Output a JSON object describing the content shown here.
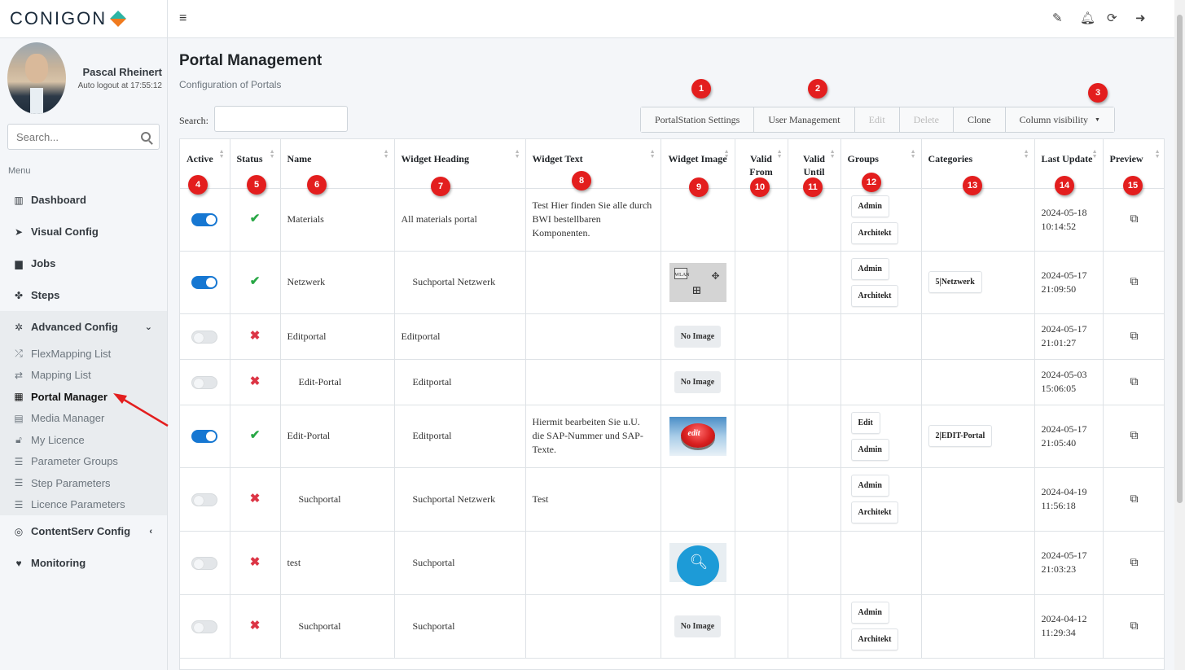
{
  "brand": {
    "name": "CONIGON"
  },
  "user": {
    "name": "Pascal Rheinert",
    "logout_text": "Auto logout at 17:55:12"
  },
  "sidebar": {
    "search_placeholder": "Search...",
    "menu_label": "Menu",
    "items": [
      {
        "label": "Dashboard",
        "icon": "chart-bar-icon",
        "glyph": "▥"
      },
      {
        "label": "Visual Config",
        "icon": "cursor-icon",
        "glyph": "➤"
      },
      {
        "label": "Jobs",
        "icon": "briefcase-icon",
        "glyph": "▆"
      },
      {
        "label": "Steps",
        "icon": "paw-icon",
        "glyph": "✤"
      },
      {
        "label": "Advanced Config",
        "icon": "gear-icon",
        "glyph": "✲",
        "chevron": "⌄"
      }
    ],
    "sub_items": [
      {
        "label": "FlexMapping List",
        "icon": "shuffle-icon",
        "glyph": "⤮"
      },
      {
        "label": "Mapping List",
        "icon": "exchange-icon",
        "glyph": "⇄"
      },
      {
        "label": "Portal Manager",
        "icon": "grid-icon",
        "glyph": "▦",
        "active": true
      },
      {
        "label": "Media Manager",
        "icon": "file-image-icon",
        "glyph": "▤"
      },
      {
        "label": "My Licence",
        "icon": "unlock-icon",
        "glyph": "🔓︎"
      },
      {
        "label": "Parameter Groups",
        "icon": "sliders-icon",
        "glyph": "☰"
      },
      {
        "label": "Step Parameters",
        "icon": "sliders-icon",
        "glyph": "☰"
      },
      {
        "label": "Licence Parameters",
        "icon": "sliders-icon",
        "glyph": "☰"
      }
    ],
    "items_after": [
      {
        "label": "ContentServ Config",
        "icon": "circle-dot-icon",
        "glyph": "◎",
        "chevron": "‹"
      },
      {
        "label": "Monitoring",
        "icon": "heartbeat-icon",
        "glyph": "♥"
      }
    ]
  },
  "page": {
    "title": "Portal Management",
    "subtitle": "Configuration of Portals",
    "search_label": "Search:"
  },
  "toolbar": {
    "buttons": [
      {
        "label": "PortalStation Settings",
        "disabled": false
      },
      {
        "label": "User Management",
        "disabled": false
      },
      {
        "label": "Edit",
        "disabled": true
      },
      {
        "label": "Delete",
        "disabled": true
      },
      {
        "label": "Clone",
        "disabled": false
      },
      {
        "label": "Column visibility",
        "disabled": false,
        "caret": "▼"
      }
    ]
  },
  "table": {
    "headers": [
      "Active",
      "Status",
      "Name",
      "Widget Heading",
      "Widget Text",
      "Widget Image",
      "Valid From",
      "Valid Until",
      "Groups",
      "Categories",
      "Last Update",
      "Preview"
    ],
    "rows": [
      {
        "active": true,
        "status": "ok",
        "name": "Materials",
        "heading": "All materials portal",
        "text": "Test Hier finden Sie alle durch BWI bestellbaren Komponenten.",
        "image": "",
        "groups": [
          "Admin",
          "Architekt"
        ],
        "categories": [],
        "updated": "2024-05-18 10:14:52"
      },
      {
        "active": true,
        "status": "ok",
        "name": "Netzwerk",
        "heading": "Suchportal Netzwerk",
        "text": "",
        "image": "network",
        "image_text": "WLAN",
        "groups": [
          "Admin",
          "Architekt"
        ],
        "categories": [
          "5|Netzwerk"
        ],
        "updated": "2024-05-17 21:09:50"
      },
      {
        "active": false,
        "status": "no",
        "name": "Editportal",
        "heading": "Editportal",
        "text": "",
        "image": "none",
        "groups": [],
        "categories": [],
        "updated": "2024-05-17 21:01:27"
      },
      {
        "active": false,
        "status": "no",
        "name": "Edit-Portal",
        "heading": "Editportal",
        "text": "",
        "image": "none",
        "groups": [],
        "categories": [],
        "updated": "2024-05-03 15:06:05"
      },
      {
        "active": true,
        "status": "ok",
        "name": "Edit-Portal",
        "heading": "Editportal",
        "text": "Hiermit bearbeiten Sie u.U. die SAP-Nummer und SAP-Texte.",
        "image": "edit",
        "image_text": "edit",
        "groups": [
          "Edit",
          "Admin"
        ],
        "categories": [
          "2|EDIT-Portal"
        ],
        "updated": "2024-05-17 21:05:40"
      },
      {
        "active": false,
        "status": "no",
        "name": "Suchportal",
        "heading": "Suchportal Netzwerk",
        "text": "Test",
        "image": "",
        "groups": [
          "Admin",
          "Architekt"
        ],
        "categories": [],
        "updated": "2024-04-19 11:56:18"
      },
      {
        "active": false,
        "status": "no",
        "name": "test",
        "heading": "Suchportal",
        "text": "",
        "image": "search",
        "groups": [],
        "categories": [],
        "updated": "2024-05-17 21:03:23"
      },
      {
        "active": false,
        "status": "no",
        "name": "Suchportal",
        "heading": "Suchportal",
        "text": "",
        "image": "none",
        "groups": [
          "Admin",
          "Architekt"
        ],
        "categories": [],
        "updated": "2024-04-12 11:29:34"
      }
    ],
    "no_image_label": "No Image",
    "status_glyphs": {
      "ok": "✔",
      "no": "✖"
    },
    "preview_glyph": "⧉"
  },
  "annotations": [
    "1",
    "2",
    "3",
    "4",
    "5",
    "6",
    "7",
    "8",
    "9",
    "10",
    "11",
    "12",
    "13",
    "14",
    "15"
  ],
  "colors": {
    "accent": "#1677d2",
    "marker": "#e31e1e",
    "ok": "#28a745",
    "no": "#dc3545"
  }
}
